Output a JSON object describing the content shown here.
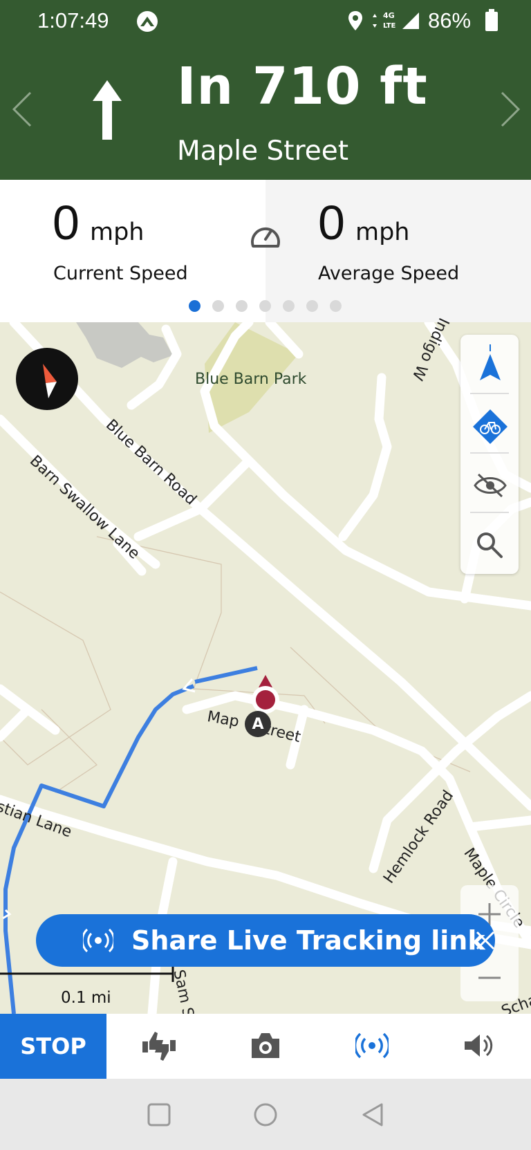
{
  "status_bar": {
    "time": "1:07:49",
    "network": "4G LTE",
    "battery": "86%"
  },
  "turn": {
    "distance": "In 710 ft",
    "street": "Maple Street",
    "direction_icon": "arrow-up-icon"
  },
  "speed": {
    "current_value": "0",
    "current_unit": "mph",
    "current_label": "Current Speed",
    "average_value": "0",
    "average_unit": "mph",
    "average_label": "Average Speed",
    "page_count": 7,
    "active_page": 1
  },
  "map": {
    "labels": {
      "park": "Blue Barn Park",
      "blue_barn_road": "Blue Barn Road",
      "barn_swallow": "Barn Swallow Lane",
      "indigo": "Indigo W",
      "maple_street_a": "Map",
      "maple_street_b": "treet",
      "hemlock": "Hemlock Road",
      "maple_circle": "Maple Circle",
      "stian_lane": "stian Lane",
      "sam_st": "Sam St",
      "scha": "Scha",
      "marker_letter": "A"
    },
    "scale_label": "0.1 mi"
  },
  "share_banner": {
    "text": "Share Live Tracking link"
  },
  "toolbar": {
    "stop_label": "STOP"
  },
  "colors": {
    "header_bg": "#345a30",
    "accent_blue": "#1a72d9",
    "route_blue": "#3d7fe0",
    "position_marker": "#a4213d"
  }
}
